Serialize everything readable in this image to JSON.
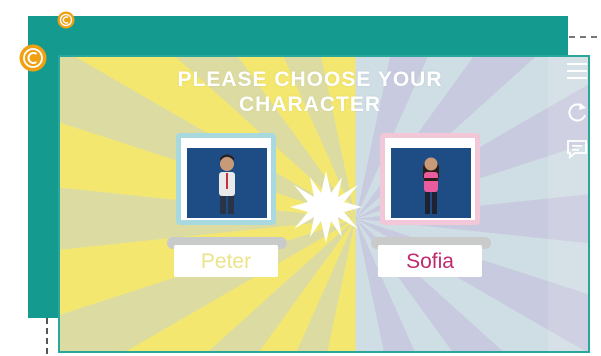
{
  "title": "PLEASE CHOOSE YOUR CHARACTER",
  "characters": [
    {
      "name": "Peter",
      "frame_color": "#a7d9df",
      "name_color": "#ece38a"
    },
    {
      "name": "Sofia",
      "frame_color": "#f2c8d8",
      "name_color": "#c02a6d"
    }
  ],
  "toolbar": {
    "icons": [
      "menu-icon",
      "restart-icon",
      "chat-icon"
    ]
  },
  "colors": {
    "frame_teal": "#159a90",
    "sunburst_yellow": "#f3e76f",
    "sunburst_lavender": "#c8cadf",
    "coin_orange": "#f0a113"
  }
}
